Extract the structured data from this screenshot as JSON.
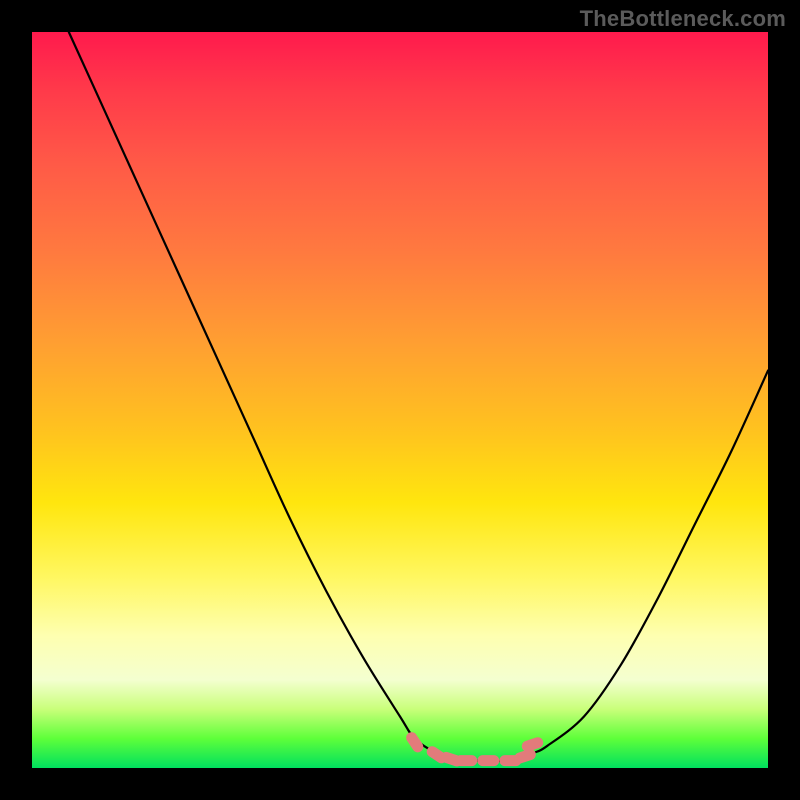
{
  "watermark": "TheBottleneck.com",
  "colors": {
    "page_bg": "#000000",
    "curve_stroke": "#000000",
    "marker_fill": "#e27b7b",
    "marker_stroke": "#d46a6a"
  },
  "chart_data": {
    "type": "line",
    "title": "",
    "xlabel": "",
    "ylabel": "",
    "xlim": [
      0,
      100
    ],
    "ylim": [
      0,
      100
    ],
    "grid": false,
    "legend": false,
    "series": [
      {
        "name": "curve",
        "x": [
          5,
          10,
          15,
          20,
          25,
          30,
          35,
          40,
          45,
          50,
          52,
          55,
          58,
          60,
          62,
          65,
          68,
          70,
          75,
          80,
          85,
          90,
          95,
          100
        ],
        "y": [
          100,
          89,
          78,
          67,
          56,
          45,
          34,
          24,
          15,
          7,
          4,
          2,
          1,
          1,
          1,
          1,
          2,
          3,
          7,
          14,
          23,
          33,
          43,
          54
        ]
      }
    ],
    "markers": {
      "name": "salmon-dashes",
      "style": "pill",
      "x": [
        52,
        55,
        57,
        59,
        62,
        65,
        67,
        68
      ],
      "y": [
        3.5,
        1.8,
        1.2,
        1.0,
        1.0,
        1.0,
        1.6,
        3.2
      ]
    }
  }
}
